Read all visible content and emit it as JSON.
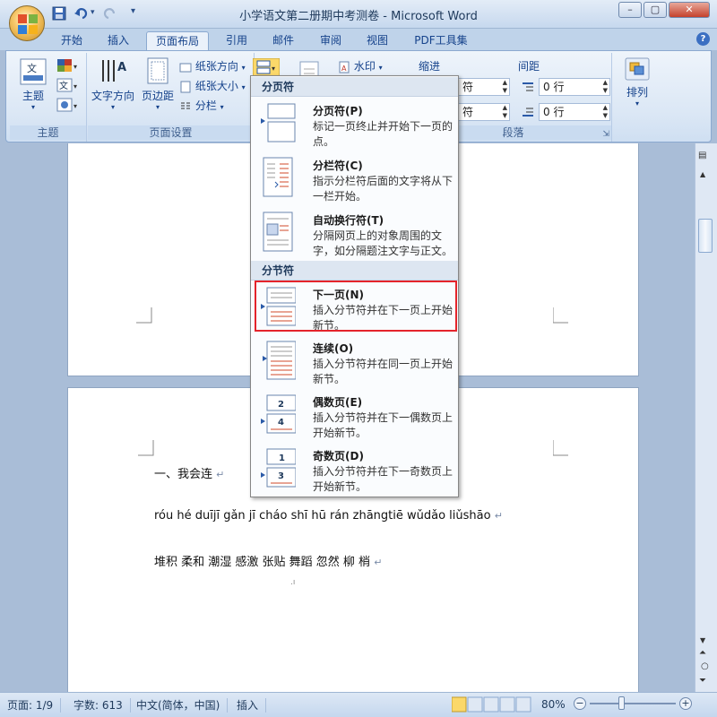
{
  "window": {
    "title": "小学语文第二册期中考测卷 - Microsoft Word",
    "minimize_label": "–",
    "maximize_label": "▢",
    "close_label": "✕"
  },
  "quick_access": {
    "save_icon": "save-icon",
    "undo_icon": "undo-icon",
    "redo_icon": "redo-icon",
    "customize_label": "▾"
  },
  "tabs": [
    {
      "label": "开始",
      "active": false
    },
    {
      "label": "插入",
      "active": false
    },
    {
      "label": "页面布局",
      "active": true
    },
    {
      "label": "引用",
      "active": false
    },
    {
      "label": "邮件",
      "active": false
    },
    {
      "label": "审阅",
      "active": false
    },
    {
      "label": "视图",
      "active": false
    },
    {
      "label": "PDF工具集",
      "active": false
    }
  ],
  "help_label": "?",
  "ribbon": {
    "theme_group": {
      "label": "主题",
      "theme_button": "主题"
    },
    "page_setup_group": {
      "label": "页面设置",
      "text_direction": "文字方向",
      "margins": "页边距",
      "orientation": "纸张方向",
      "size": "纸张大小",
      "columns": "分栏"
    },
    "background_group": {
      "watermark": "水印"
    },
    "paragraph_group": {
      "label": "段落",
      "indent_label": "缩进",
      "spacing_label": "间距",
      "indent_left_value": "符",
      "indent_right_value": "符",
      "spacing_before_value": "0 行",
      "spacing_after_value": "0 行"
    },
    "arrange_group": {
      "label": "排列"
    }
  },
  "dropdown": {
    "section1_header": "分页符",
    "section2_header": "分节符",
    "items": [
      {
        "title": "分页符(P)",
        "desc": "标记一页终止并开始下一页的点。"
      },
      {
        "title": "分栏符(C)",
        "desc": "指示分栏符后面的文字将从下一栏开始。"
      },
      {
        "title": "自动换行符(T)",
        "desc": "分隔网页上的对象周围的文字，如分隔题注文字与正文。"
      },
      {
        "title": "下一页(N)",
        "desc": "插入分节符并在下一页上开始新节。"
      },
      {
        "title": "连续(O)",
        "desc": "插入分节符并在同一页上开始新节。"
      },
      {
        "title": "偶数页(E)",
        "desc": "插入分节符并在下一偶数页上开始新节。"
      },
      {
        "title": "奇数页(D)",
        "desc": "插入分节符并在下一奇数页上开始新节。"
      }
    ],
    "even_page_number": "2",
    "even_page_number2": "4",
    "odd_page_number": "1",
    "odd_page_number2": "3"
  },
  "document": {
    "line1": "一、我会连",
    "line2": "róu hé duījī gǎn jī cháo shī hū rán zhāngtiē wǔdǎo liǔshāo",
    "line3": "堆积 柔和 潮湿 感激 张贴 舞蹈 忽然 柳 梢",
    "para_mark": "↵"
  },
  "status": {
    "page": "页面: 1/9",
    "words": "字数: 613",
    "language": "中文(简体，中国)",
    "mode": "插入",
    "zoom": "80%",
    "zoom_out": "−",
    "zoom_in": "+"
  }
}
